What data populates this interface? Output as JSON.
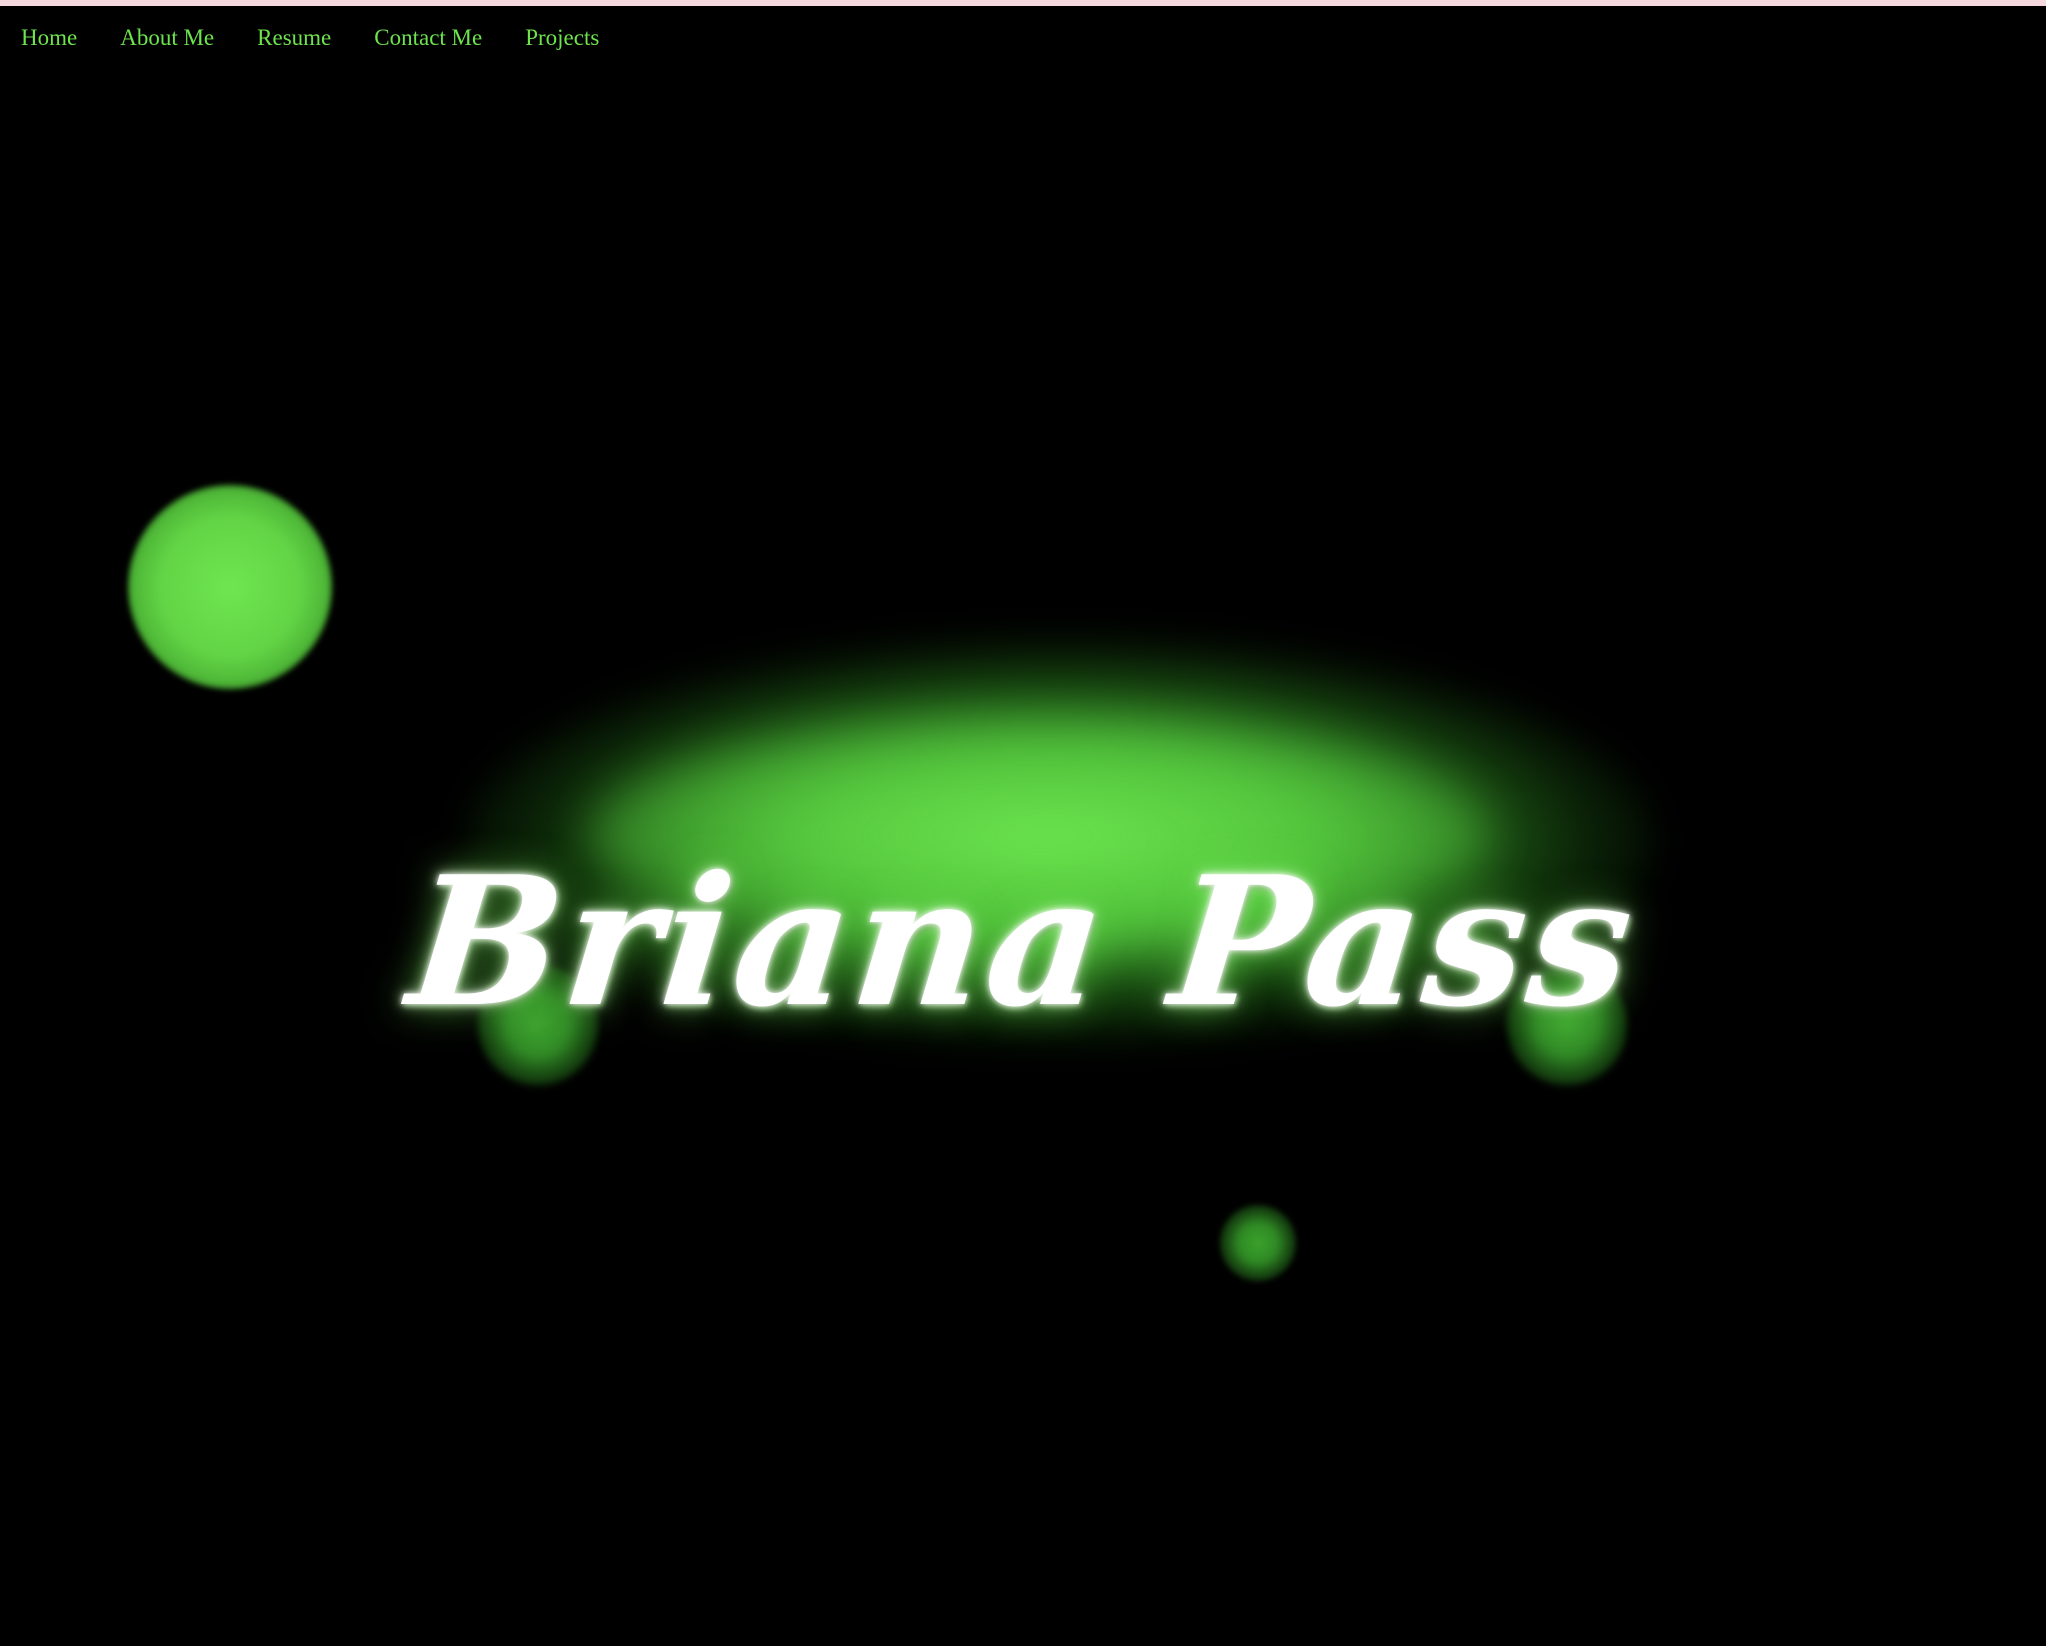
{
  "nav": {
    "items": [
      {
        "label": "Home"
      },
      {
        "label": "About Me"
      },
      {
        "label": "Resume"
      },
      {
        "label": "Contact Me"
      },
      {
        "label": "Projects"
      }
    ]
  },
  "hero": {
    "title": "Briana Pass"
  },
  "colors": {
    "background": "#000000",
    "nav_text": "#6de34d",
    "glow": "#5fdc46",
    "top_strip": "#f6d9df",
    "title_text": "#ffffff"
  }
}
